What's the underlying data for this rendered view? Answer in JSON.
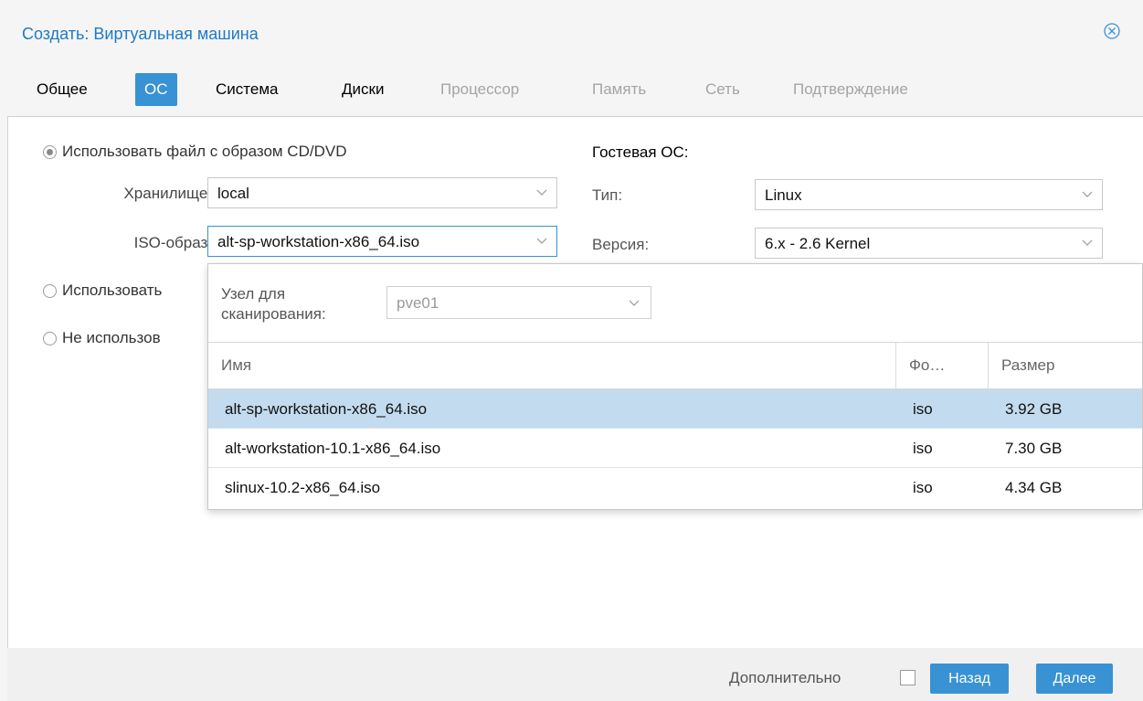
{
  "window": {
    "title": "Создать: Виртуальная машина"
  },
  "tabs": [
    {
      "label": "Общее",
      "state": "enabled"
    },
    {
      "label": "ОС",
      "state": "active"
    },
    {
      "label": "Система",
      "state": "enabled"
    },
    {
      "label": "Диски",
      "state": "enabled"
    },
    {
      "label": "Процессор",
      "state": "disabled"
    },
    {
      "label": "Память",
      "state": "disabled"
    },
    {
      "label": "Сеть",
      "state": "disabled"
    },
    {
      "label": "Подтверждение",
      "state": "disabled"
    }
  ],
  "media": {
    "option_iso": "Использовать файл с образом CD/DVD",
    "option_physical": "Использовать",
    "option_none": "Не использов",
    "storage_label": "Хранилище:",
    "storage_value": "local",
    "iso_label": "ISO-образ:",
    "iso_value": "alt-sp-workstation-x86_64.iso"
  },
  "guest": {
    "heading": "Гостевая ОС:",
    "type_label": "Тип:",
    "type_value": "Linux",
    "version_label": "Версия:",
    "version_value": "6.x - 2.6 Kernel"
  },
  "picker": {
    "node_label": "Узел для сканирования:",
    "node_value": "pve01",
    "columns": {
      "name": "Имя",
      "format": "Фо…",
      "size": "Размер"
    },
    "rows": [
      {
        "name": "alt-sp-workstation-x86_64.iso",
        "format": "iso",
        "size": "3.92 GB",
        "selected": true
      },
      {
        "name": "alt-workstation-10.1-x86_64.iso",
        "format": "iso",
        "size": "7.30 GB",
        "selected": false
      },
      {
        "name": "slinux-10.2-x86_64.iso",
        "format": "iso",
        "size": "4.34 GB",
        "selected": false
      }
    ]
  },
  "footer": {
    "advanced_label": "Дополнительно",
    "back_label": "Назад",
    "next_label": "Далее"
  },
  "colors": {
    "accent": "#3892d4",
    "title": "#1f7ac5",
    "selected_row": "#c3dbee"
  }
}
